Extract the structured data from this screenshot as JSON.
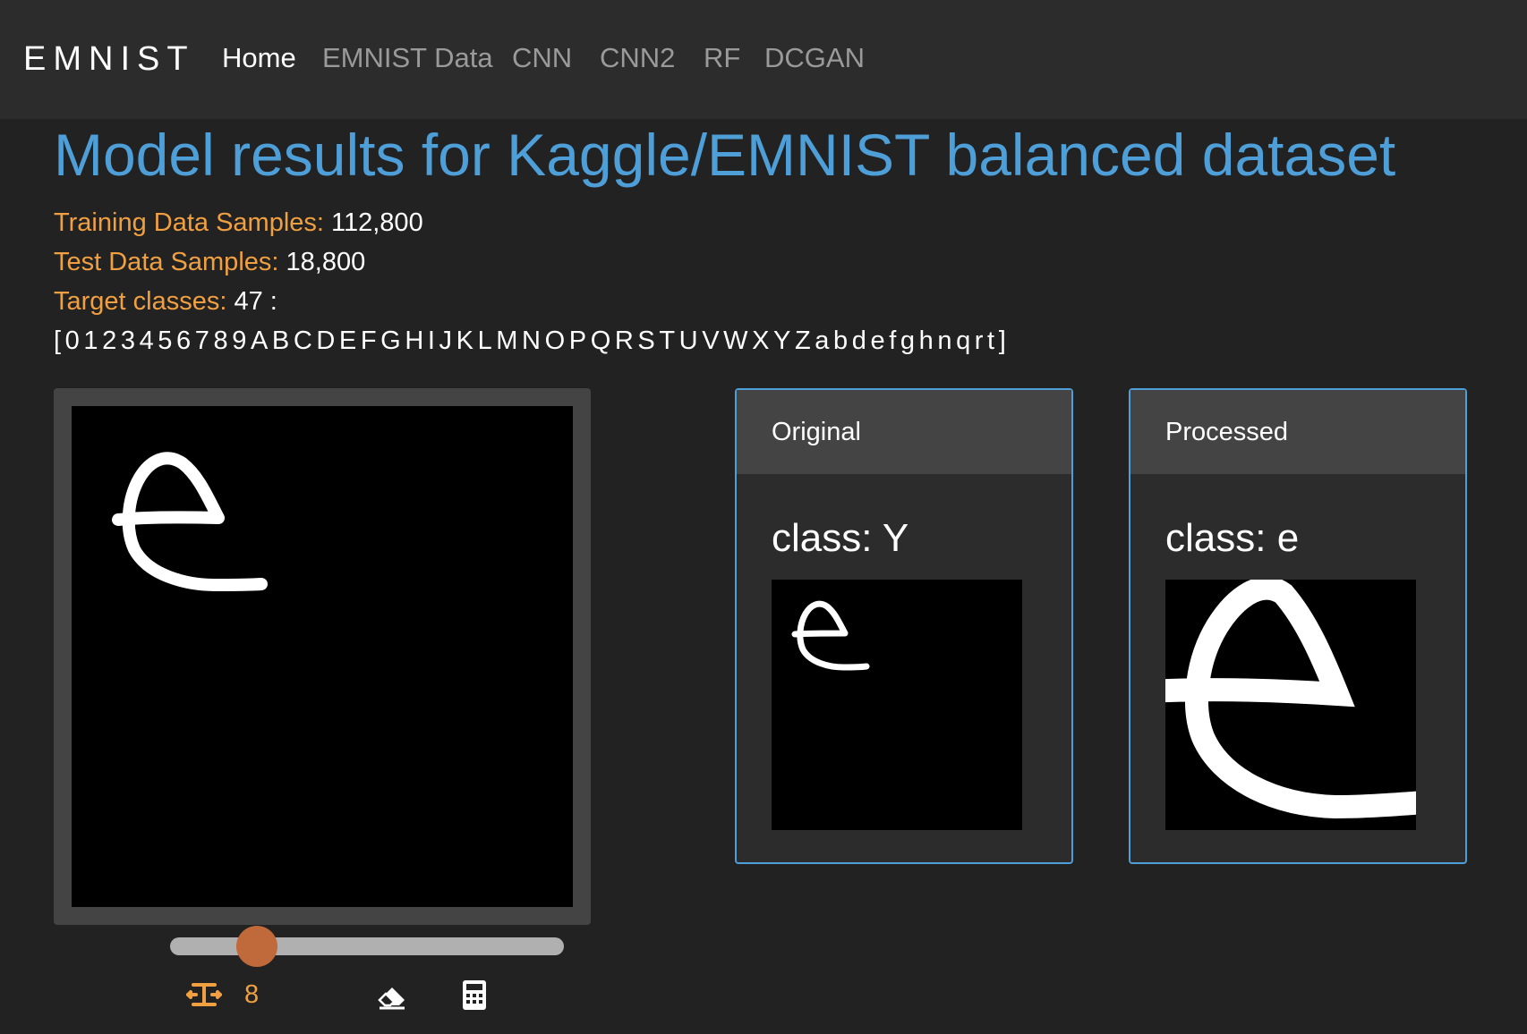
{
  "navbar": {
    "brand": "EMNIST",
    "items": [
      {
        "label": "Home",
        "active": true
      },
      {
        "label": "EMNIST Data",
        "active": false
      },
      {
        "label": "CNN",
        "active": false
      },
      {
        "label": "CNN2",
        "active": false
      },
      {
        "label": "RF",
        "active": false
      },
      {
        "label": "DCGAN",
        "active": false
      }
    ]
  },
  "page": {
    "title": "Model results for Kaggle/EMNIST balanced dataset",
    "training_label": "Training Data Samples:",
    "training_value": "112,800",
    "test_label": "Test Data Samples:",
    "test_value": "18,800",
    "target_label": "Target classes:",
    "target_value": "47 :",
    "class_list": "[0123456789ABCDEFGHIJKLMNOPQRSTUVWXYZabdefghnqrt]"
  },
  "canvas": {
    "brush_size": "8",
    "slider_fraction": 0.22
  },
  "icons": {
    "brush_size": "text-height-icon",
    "eraser": "eraser-icon",
    "predict": "calculator-icon"
  },
  "cards": {
    "original": {
      "header": "Original",
      "class_text": "class: Y"
    },
    "processed": {
      "header": "Processed",
      "class_text": "class: e"
    }
  },
  "colors": {
    "accent_blue": "#4e9ed8",
    "label_orange": "#f0a040",
    "slider_thumb": "#c0693a",
    "background": "#222222",
    "navbar": "#2c2c2c"
  }
}
